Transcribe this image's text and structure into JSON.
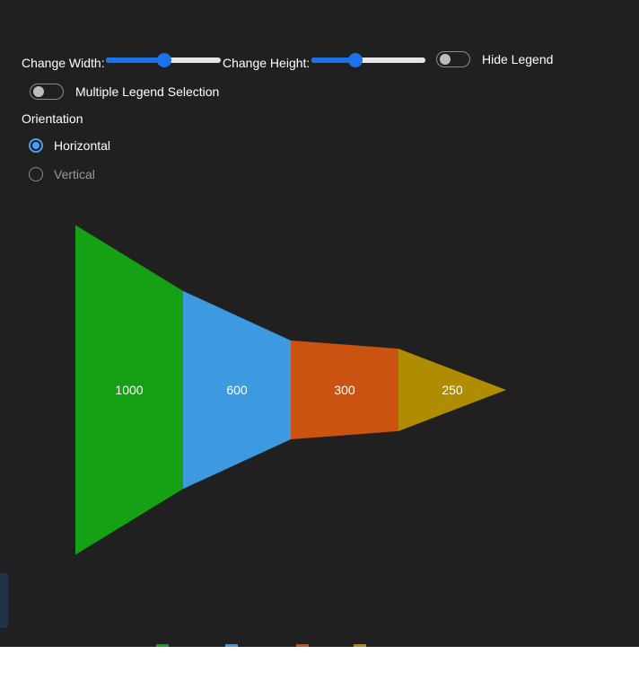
{
  "controls": {
    "change_width_label": "Change Width:",
    "change_height_label": "Change Height:",
    "hide_legend_label": "Hide Legend",
    "multiple_legend_label": "Multiple Legend Selection",
    "orientation_label": "Orientation",
    "width_slider_value": 0.5,
    "height_slider_value": 0.38,
    "hide_legend_on": false,
    "multiple_legend_on": false,
    "orientation_options": [
      {
        "label": "Horizontal",
        "selected": true
      },
      {
        "label": "Vertical",
        "selected": false
      }
    ]
  },
  "colors": {
    "accent": "#1a73e8",
    "background": "#202020"
  },
  "chart_data": {
    "type": "funnel",
    "orientation": "horizontal",
    "values": [
      1000,
      600,
      300,
      250
    ],
    "labels": [
      "1000",
      "600",
      "300",
      "250"
    ],
    "colors": [
      "#16a013",
      "#3d99e0",
      "#cb5311",
      "#b08c00"
    ],
    "legend": "bottom"
  }
}
